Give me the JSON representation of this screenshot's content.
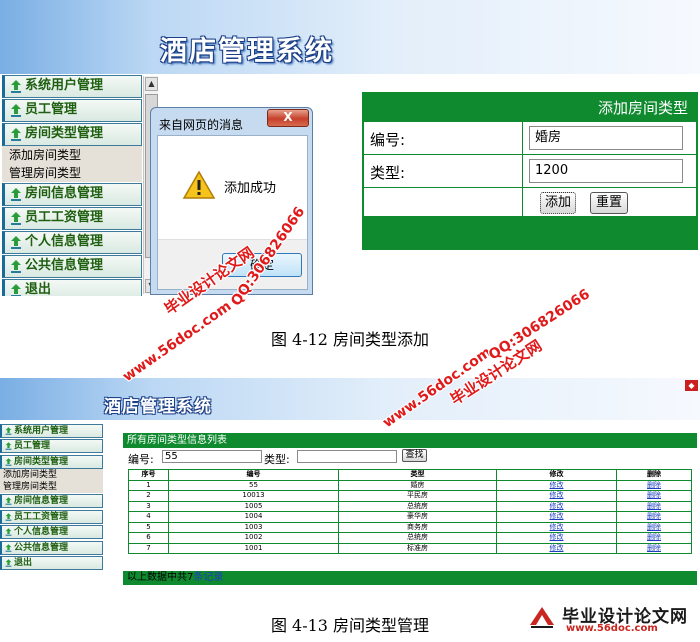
{
  "fig1": {
    "app_title": "酒店管理系统",
    "nav": [
      {
        "label": "系统用户管理"
      },
      {
        "label": "员工管理"
      },
      {
        "label": "房间类型管理",
        "subs": [
          "添加房间类型",
          "管理房间类型"
        ]
      },
      {
        "label": "房间信息管理"
      },
      {
        "label": "员工工资管理"
      },
      {
        "label": "个人信息管理"
      },
      {
        "label": "公共信息管理"
      },
      {
        "label": "退出"
      }
    ],
    "dialog": {
      "title": "来自网页的消息",
      "close_label": "X",
      "message": "添加成功",
      "ok_label": "确定"
    },
    "form": {
      "header": "添加房间类型",
      "number_label": "编号:",
      "number_value": "婚房",
      "type_label": "类型:",
      "type_value": "1200",
      "add_button": "添加",
      "reset_button": "重置"
    },
    "caption": "图 4-12 房间类型添加"
  },
  "fig2": {
    "app_title": "酒店管理系统",
    "nav": [
      {
        "label": "系统用户管理"
      },
      {
        "label": "员工管理"
      },
      {
        "label": "房间类型管理",
        "subs": [
          "添加房间类型",
          "管理房间类型"
        ]
      },
      {
        "label": "房间信息管理"
      },
      {
        "label": "员工工资管理"
      },
      {
        "label": "个人信息管理"
      },
      {
        "label": "公共信息管理"
      },
      {
        "label": "退出"
      }
    ],
    "panel_title": "所有房间类型信息列表",
    "search": {
      "number_label": "编号:",
      "number_value": "55",
      "type_label": "类型:",
      "type_value": "",
      "search_button": "查找"
    },
    "table": {
      "columns": [
        "序号",
        "编号",
        "类型",
        "修改",
        "删除"
      ],
      "rows": [
        [
          "1",
          "55",
          "婚房",
          "修改",
          "删除"
        ],
        [
          "2",
          "10013",
          "平民房",
          "修改",
          "删除"
        ],
        [
          "3",
          "1005",
          "总统房",
          "修改",
          "删除"
        ],
        [
          "4",
          "1004",
          "豪华房",
          "修改",
          "删除"
        ],
        [
          "5",
          "1003",
          "商务房",
          "修改",
          "删除"
        ],
        [
          "6",
          "1002",
          "总统房",
          "修改",
          "删除"
        ],
        [
          "7",
          "1001",
          "标准房",
          "修改",
          "删除"
        ]
      ]
    },
    "footer_text": "以上数据中共7",
    "footer_link": "条记录",
    "caption": "图 4-13 房间类型管理"
  },
  "watermarks": {
    "site_name": "毕业设计论文网",
    "qq": "QQ:306826066",
    "url": "www.56doc.com"
  },
  "logo": {
    "name": "毕业设计论文网",
    "url": "www.56doc.com"
  },
  "colors": {
    "green": "#0f8a2f",
    "watermark_red": "#e01a1a",
    "nav_text": "#1e5f10"
  }
}
